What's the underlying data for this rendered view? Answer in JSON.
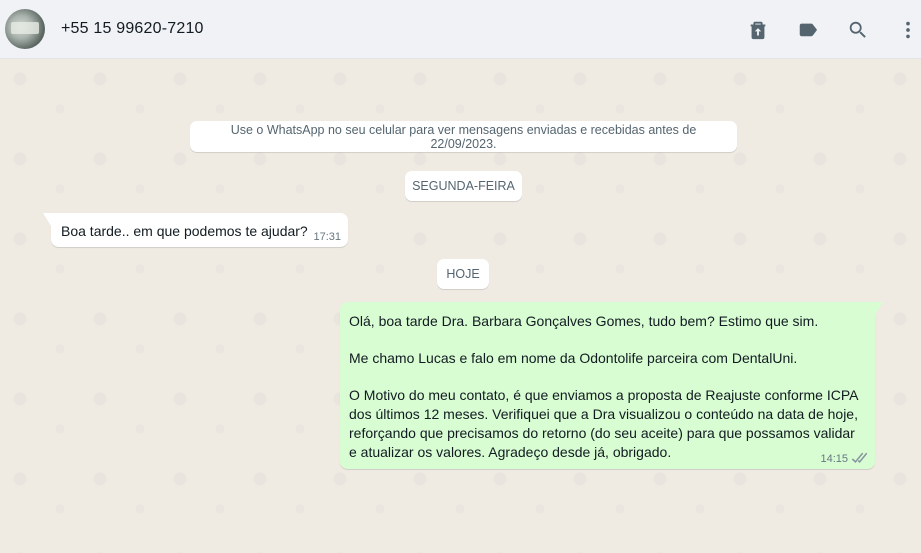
{
  "header": {
    "contact_name": "+55 15 99620-7210",
    "icons": [
      "delete-icon",
      "label-icon",
      "search-icon",
      "menu-icon"
    ]
  },
  "chat": {
    "system_notice": "Use o WhatsApp no seu celular para ver mensagens enviadas e recebidas antes de 22/09/2023.",
    "day_chip_1": "SEGUNDA-FEIRA",
    "day_chip_2": "HOJE",
    "incoming": {
      "text": "Boa tarde.. em que podemos te ajudar?",
      "time": "17:31"
    },
    "outgoing": {
      "line1": "Olá, boa tarde Dra. Barbara Gonçalves Gomes, tudo bem? Estimo que sim.",
      "line2": "Me chamo Lucas e falo em nome da Odontolife parceira com DentalUni.",
      "line3a": "O Motivo do meu contato, é que enviamos a proposta de Reajuste conforme ICPA",
      "line3b": "dos últimos 12 meses. Verifiquei que a Dra visualizou o conteúdo na data de hoje,",
      "line3c": "reforçando que precisamos do retorno (do seu aceite) para que possamos validar",
      "line3d": "e atualizar os valores. Agradeço desde já, obrigado.",
      "time": "14:15",
      "status": "read-ticks-icon"
    }
  },
  "colors": {
    "header_bg": "#f0f2f5",
    "chat_bg": "#efeae2",
    "outgoing_bg": "#d9fdd3",
    "incoming_bg": "#ffffff",
    "icon_color": "#54656f"
  }
}
